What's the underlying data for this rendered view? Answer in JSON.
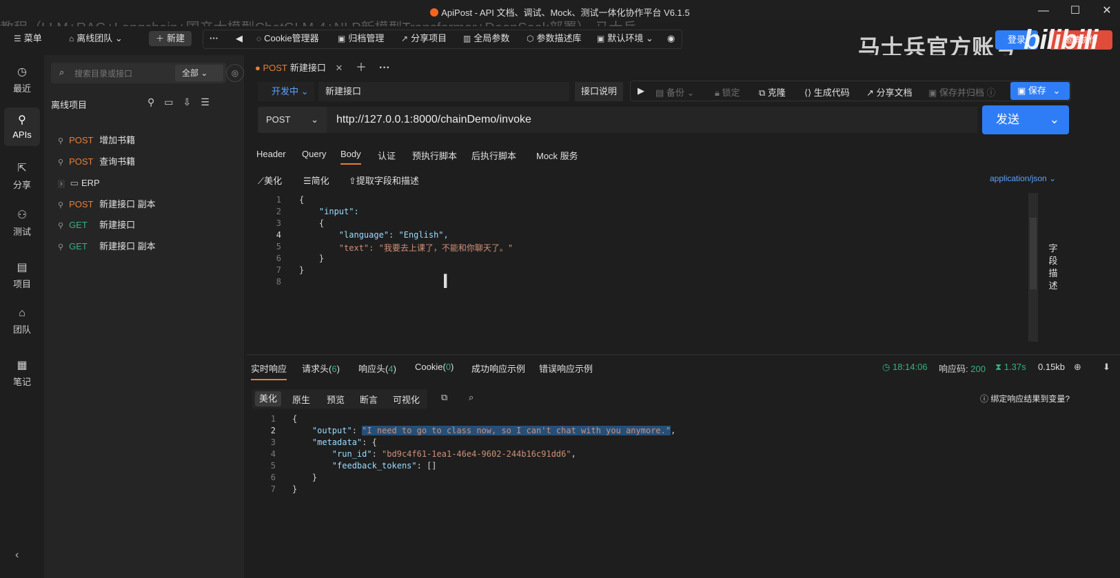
{
  "window": {
    "title": "ApiPost - API 文档、调试、Mock、测试一体化协作平台 V6.1.5",
    "overlay_text": "教程（LLM+RAG+Langchain+国产大模型ChatGLM-4+NLP新模型Transformer+DeepSeek部署）-马士兵"
  },
  "topbar": {
    "menu": "菜单",
    "team": "离线团队",
    "new": "新建",
    "cookie": "Cookie管理器",
    "archive": "归档管理",
    "share": "分享项目",
    "global_params": "全局参数",
    "param_lib": "参数描述库",
    "env": "默认环境",
    "brand_watermark": "马士兵官方账号",
    "login": "登录",
    "invite": "邀请协作",
    "bilibili": "bilibili"
  },
  "leftnav": [
    {
      "label": "最近",
      "icon": "clock-icon"
    },
    {
      "label": "APIs",
      "icon": "api-icon"
    },
    {
      "label": "分享",
      "icon": "share-icon"
    },
    {
      "label": "测试",
      "icon": "test-icon"
    },
    {
      "label": "项目",
      "icon": "project-icon"
    },
    {
      "label": "团队",
      "icon": "team-icon"
    },
    {
      "label": "笔记",
      "icon": "note-icon"
    }
  ],
  "sidebar": {
    "search_placeholder": "搜索目录或接口",
    "scope": "全部",
    "project_title": "离线项目",
    "items": [
      {
        "method": "POST",
        "name": "增加书籍"
      },
      {
        "method": "POST",
        "name": "查询书籍"
      },
      {
        "method": "",
        "name": "ERP"
      },
      {
        "method": "POST",
        "name": "新建接口 副本"
      },
      {
        "method": "GET",
        "name": "新建接口"
      },
      {
        "method": "GET",
        "name": "新建接口 副本"
      }
    ]
  },
  "tab": {
    "method": "POST",
    "name": "新建接口"
  },
  "request": {
    "status": "开发中",
    "api_name": "新建接口",
    "desc_btn": "接口说明",
    "actions": {
      "backup": "备份",
      "lock": "锁定",
      "clone": "克隆",
      "gen_code": "生成代码",
      "share_doc": "分享文档",
      "save_archive": "保存并归档",
      "save": "保存"
    },
    "method": "POST",
    "url": "http://127.0.0.1:8000/chainDemo/invoke",
    "send": "发送",
    "tabs": [
      "Header",
      "Query",
      "Body",
      "认证",
      "预执行脚本",
      "后执行脚本",
      "Mock 服务"
    ],
    "tools": {
      "beautify": "美化",
      "simplify": "简化",
      "extract": "提取字段和描述"
    },
    "content_type": "application/json",
    "body_lines": [
      "{",
      "    \"input\":",
      "    {",
      "        \"language\": \"English\",",
      "        \"text\": \"我要去上课了，不能和你聊天了。\"",
      "    }",
      "}",
      ""
    ],
    "field_desc": "字段描述"
  },
  "response": {
    "tabs": {
      "realtime": "实时响应",
      "req_headers": "请求头",
      "req_headers_count": "6",
      "resp_headers": "响应头",
      "resp_headers_count": "4",
      "cookie": "Cookie",
      "cookie_count": "0",
      "success_example": "成功响应示例",
      "error_example": "错误响应示例"
    },
    "time": "18:14:06",
    "status_label": "响应码:",
    "status_code": "200",
    "duration": "1.37s",
    "size": "0.15kb",
    "view_modes": [
      "美化",
      "原生",
      "预览",
      "断言",
      "可视化"
    ],
    "bind_label": "绑定响应结果到变量?",
    "body": {
      "output": "I need to go to class now, so I can't chat with you anymore.",
      "run_id": "bd9c4f61-1ea1-46e4-9602-244b16c91dd6"
    }
  }
}
